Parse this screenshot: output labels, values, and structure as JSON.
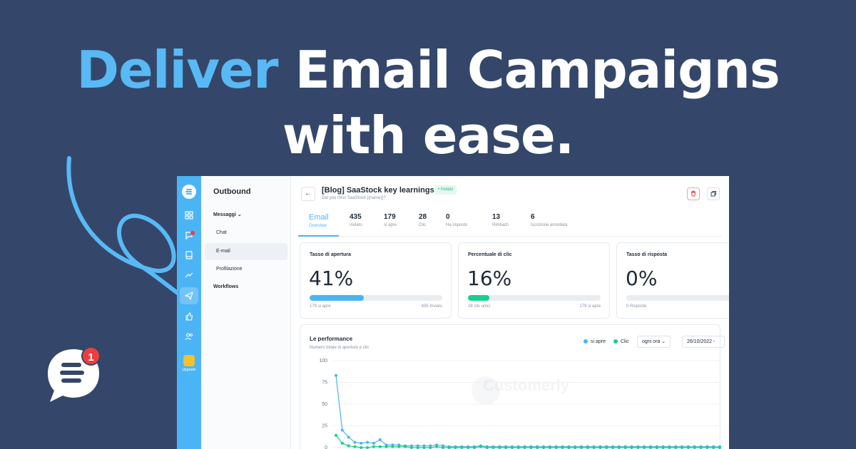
{
  "headline": {
    "accent": "Deliver",
    "line1_rest": "Email Campaigns",
    "line2": "with ease."
  },
  "floating_badge": {
    "count": "1"
  },
  "rail": {
    "upgrade_label": "Upgrade"
  },
  "subnav": {
    "title": "Outbound",
    "group": "Messaggi",
    "items": [
      "Chat",
      "E-mail",
      "Profilazione"
    ],
    "active_item": "E-mail",
    "workflows": "Workflows"
  },
  "campaign": {
    "title": "[Blog] SaaStock key learnings",
    "subject": "Did you miss SaaStock {{name}}?",
    "status": "• Inviato"
  },
  "tabs": [
    {
      "num": "Email",
      "label": "Overview",
      "active": true
    },
    {
      "num": "435",
      "label": "Inviato"
    },
    {
      "num": "179",
      "label": "si apre"
    },
    {
      "num": "28",
      "label": "Clic"
    },
    {
      "num": "0",
      "label": "Ha risposto"
    },
    {
      "num": "13",
      "label": "Rimbalzi"
    },
    {
      "num": "6",
      "label": "Iscrizione annullata"
    }
  ],
  "cards": [
    {
      "title": "Tasso di apertura",
      "value": "41%",
      "fill": 0.41,
      "color": "#4bb4f5",
      "foot_left": "179 si apre",
      "foot_right": "435 Inviato"
    },
    {
      "title": "Percentuale di clic",
      "value": "16%",
      "fill": 0.16,
      "color": "#19cf8b",
      "foot_left": "28 clic unici",
      "foot_right": "179 si apre"
    },
    {
      "title": "Tasso di risposta",
      "value": "0%",
      "fill": 0.0,
      "color": "#4bb4f5",
      "foot_left": "0 Risposte",
      "foot_right": ""
    }
  ],
  "performance": {
    "title": "Le performance",
    "subtitle": "Numero totale di aperture e clic",
    "legend_open": "si apre",
    "legend_click": "Clic",
    "interval": "ogni ora",
    "date": "26/10/2022 -",
    "watermark": "Customerly"
  },
  "colors": {
    "accent": "#58b9f5",
    "opens": "#4bb4f5",
    "clicks": "#19cf8b",
    "background": "#34476a"
  },
  "chart_data": {
    "type": "line",
    "title": "Le performance",
    "subtitle": "Numero totale di aperture e clic",
    "ylim": [
      0,
      100
    ],
    "yticks": [
      0,
      25,
      50,
      75,
      100
    ],
    "series": [
      {
        "name": "si apre",
        "values": [
          83,
          20,
          12,
          6,
          5,
          6,
          5,
          9,
          3,
          3,
          3,
          2,
          2,
          2,
          2,
          2,
          3,
          2,
          1,
          1,
          1,
          1,
          1,
          2,
          1,
          1,
          1,
          1,
          1,
          1,
          1,
          1,
          1,
          1,
          1,
          1,
          1,
          1,
          1,
          1,
          1,
          1,
          1,
          1,
          1,
          1,
          1,
          1,
          1,
          1,
          1,
          1,
          1,
          1,
          1,
          1,
          1,
          1,
          1,
          1,
          1,
          1
        ]
      },
      {
        "name": "Clic",
        "values": [
          14,
          5,
          2,
          1,
          0,
          0,
          1,
          1,
          1,
          1,
          1,
          1,
          0,
          0,
          0,
          0,
          1,
          0,
          0,
          0,
          0,
          0,
          0,
          1,
          0,
          0,
          0,
          0,
          0,
          0,
          0,
          0,
          0,
          0,
          0,
          0,
          0,
          0,
          0,
          0,
          0,
          0,
          0,
          0,
          0,
          0,
          0,
          0,
          0,
          0,
          0,
          0,
          0,
          0,
          0,
          0,
          0,
          0,
          0,
          0,
          0,
          0
        ]
      }
    ],
    "grid": true,
    "legend": "top-right"
  }
}
